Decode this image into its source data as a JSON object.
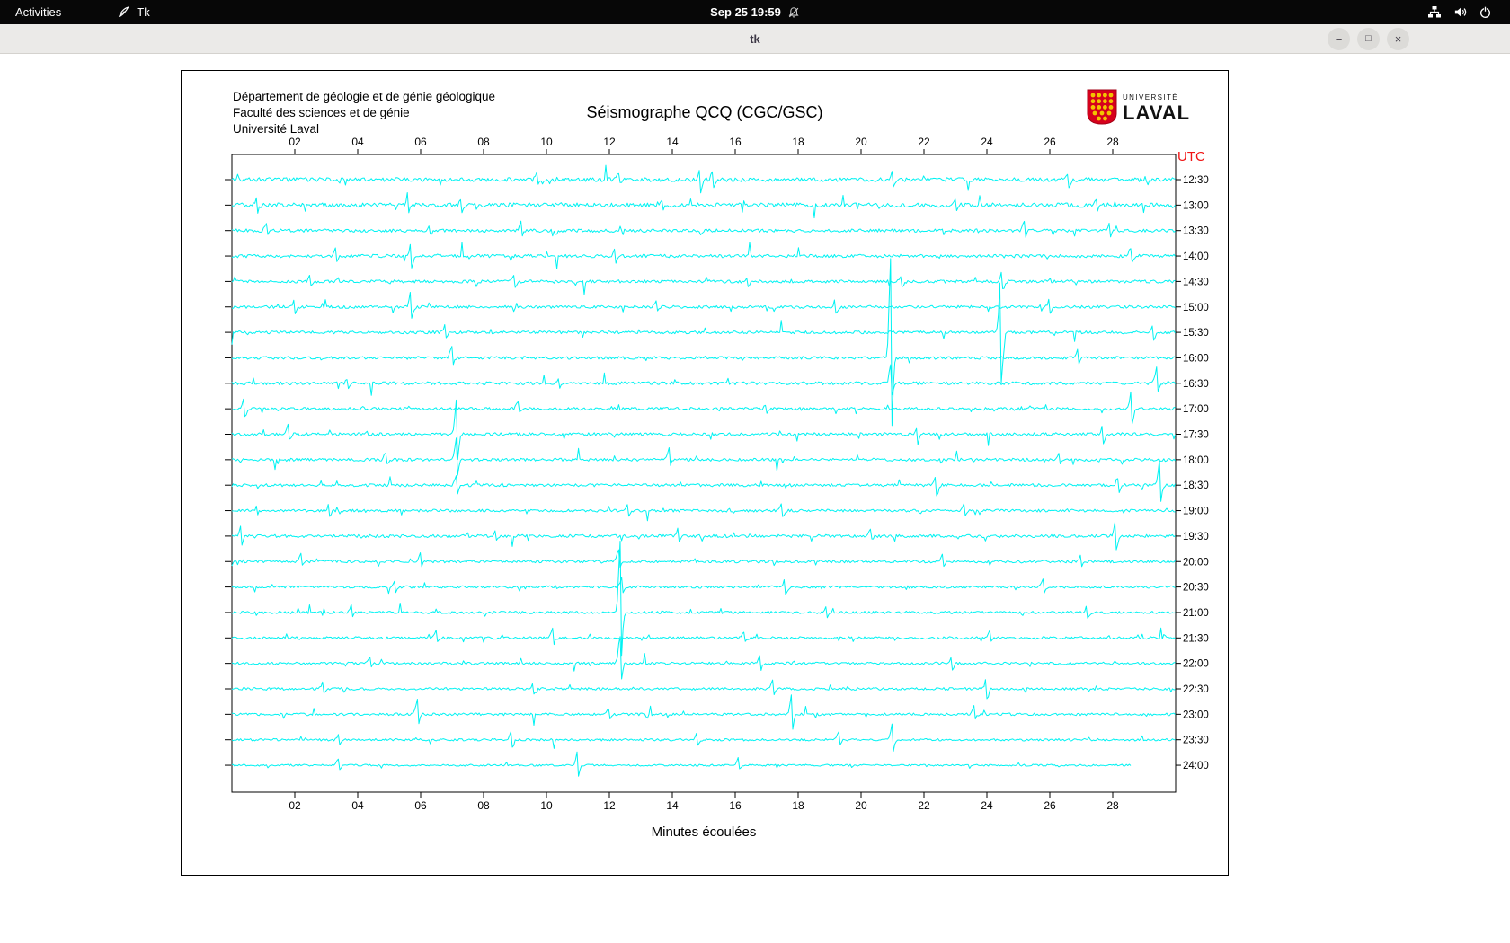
{
  "top_bar": {
    "activities": "Activities",
    "app_name": "Tk",
    "clock": "Sep 25 19:59",
    "icons": [
      "tk-feather-icon",
      "bell-muted-icon",
      "network-icon",
      "volume-icon",
      "power-icon"
    ]
  },
  "titlebar": {
    "title": "tk",
    "button_glyphs": {
      "minimize": "−",
      "maximize": "□",
      "close": "×"
    }
  },
  "seismograph": {
    "dept": [
      "Département de géologie et de génie géologique",
      "Faculté des sciences et de génie",
      "Université Laval"
    ],
    "title": "Séismographe QCQ (CGC/GSC)",
    "logo": {
      "line1": "UNIVERSITÉ",
      "line2": "LAVAL"
    },
    "utc_label": "UTC",
    "xlabel": "Minutes écoulées",
    "x_ticks": [
      "02",
      "04",
      "06",
      "08",
      "10",
      "12",
      "14",
      "16",
      "18",
      "20",
      "22",
      "24",
      "26",
      "28"
    ],
    "trace_color": "#00f2f2",
    "utc_color": "#f01414"
  },
  "chart_data": {
    "type": "line",
    "title": "Séismographe QCQ (CGC/GSC)",
    "xlabel": "Minutes écoulées",
    "ylabel_right": "UTC",
    "x_range": [
      0,
      30
    ],
    "x_ticks": [
      2,
      4,
      6,
      8,
      10,
      12,
      14,
      16,
      18,
      20,
      22,
      24,
      26,
      28
    ],
    "grid": false,
    "trace_spacing_minutes": 30,
    "traces": [
      {
        "label": "12:30",
        "seed": 1,
        "noise_amp": 2.2,
        "events": [
          [
            9.7,
            8
          ],
          [
            12.3,
            7
          ],
          [
            14.9,
            16
          ],
          [
            15.3,
            12
          ],
          [
            21.0,
            10
          ],
          [
            26.6,
            9
          ]
        ]
      },
      {
        "label": "13:00",
        "seed": 2,
        "noise_amp": 2.4,
        "events": [
          [
            0.8,
            10
          ],
          [
            5.6,
            12
          ],
          [
            7.3,
            8
          ],
          [
            13.7,
            7
          ],
          [
            23.0,
            8
          ],
          [
            27.5,
            9
          ]
        ]
      },
      {
        "label": "13:30",
        "seed": 3,
        "noise_amp": 1.8,
        "events": [
          [
            1.1,
            8
          ],
          [
            6.3,
            7
          ],
          [
            9.2,
            9
          ],
          [
            25.2,
            11
          ],
          [
            27.9,
            8
          ]
        ]
      },
      {
        "label": "14:00",
        "seed": 4,
        "noise_amp": 1.8,
        "events": [
          [
            3.3,
            9
          ],
          [
            5.7,
            16
          ],
          [
            12.2,
            8
          ],
          [
            28.6,
            9
          ]
        ]
      },
      {
        "label": "14:30",
        "seed": 5,
        "noise_amp": 1.7,
        "events": [
          [
            2.5,
            7
          ],
          [
            9.0,
            9
          ],
          [
            16.4,
            8
          ],
          [
            21.3,
            7
          ],
          [
            24.5,
            12
          ]
        ]
      },
      {
        "label": "15:00",
        "seed": 6,
        "noise_amp": 1.6,
        "events": [
          [
            2.0,
            8
          ],
          [
            5.7,
            18
          ],
          [
            13.5,
            7
          ],
          [
            19.2,
            9
          ],
          [
            26.0,
            10
          ]
        ]
      },
      {
        "label": "15:30",
        "seed": 7,
        "noise_amp": 1.6,
        "events": [
          [
            6.8,
            9
          ],
          [
            24.45,
            70
          ],
          [
            29.3,
            12
          ]
        ]
      },
      {
        "label": "16:00",
        "seed": 8,
        "noise_amp": 1.6,
        "events": [
          [
            7.0,
            14
          ],
          [
            20.95,
            115
          ],
          [
            26.9,
            10
          ]
        ]
      },
      {
        "label": "16:30",
        "seed": 9,
        "noise_amp": 1.7,
        "events": [
          [
            3.7,
            8
          ],
          [
            10.4,
            7
          ],
          [
            20.95,
            20
          ],
          [
            29.4,
            16
          ]
        ]
      },
      {
        "label": "17:00",
        "seed": 10,
        "noise_amp": 1.6,
        "events": [
          [
            0.4,
            12
          ],
          [
            9.1,
            8
          ],
          [
            17.0,
            7
          ],
          [
            28.6,
            22
          ]
        ]
      },
      {
        "label": "17:30",
        "seed": 11,
        "noise_amp": 1.7,
        "events": [
          [
            1.8,
            10
          ],
          [
            7.15,
            42
          ],
          [
            21.8,
            9
          ],
          [
            27.7,
            12
          ]
        ]
      },
      {
        "label": "18:00",
        "seed": 12,
        "noise_amp": 1.6,
        "events": [
          [
            4.9,
            9
          ],
          [
            7.15,
            25
          ],
          [
            13.9,
            12
          ],
          [
            26.3,
            8
          ]
        ]
      },
      {
        "label": "18:30",
        "seed": 13,
        "noise_amp": 1.6,
        "events": [
          [
            7.15,
            12
          ],
          [
            22.4,
            14
          ],
          [
            28.2,
            10
          ],
          [
            29.5,
            28
          ]
        ]
      },
      {
        "label": "19:00",
        "seed": 14,
        "noise_amp": 1.5,
        "events": [
          [
            3.1,
            7
          ],
          [
            12.6,
            8
          ],
          [
            17.5,
            10
          ],
          [
            23.3,
            9
          ]
        ]
      },
      {
        "label": "19:30",
        "seed": 15,
        "noise_amp": 1.7,
        "events": [
          [
            0.3,
            12
          ],
          [
            8.4,
            8
          ],
          [
            14.2,
            9
          ],
          [
            20.3,
            8
          ],
          [
            28.1,
            18
          ]
        ]
      },
      {
        "label": "20:00",
        "seed": 16,
        "noise_amp": 1.5,
        "events": [
          [
            2.2,
            8
          ],
          [
            6.0,
            9
          ],
          [
            12.3,
            14
          ],
          [
            22.6,
            8
          ],
          [
            27.0,
            7
          ]
        ]
      },
      {
        "label": "20:30",
        "seed": 17,
        "noise_amp": 1.4,
        "events": [
          [
            5.2,
            7
          ],
          [
            12.4,
            10
          ],
          [
            17.6,
            12
          ],
          [
            25.8,
            8
          ]
        ]
      },
      {
        "label": "21:00",
        "seed": 18,
        "noise_amp": 1.4,
        "events": [
          [
            3.8,
            8
          ],
          [
            12.35,
            78
          ],
          [
            18.9,
            7
          ],
          [
            27.2,
            9
          ]
        ]
      },
      {
        "label": "21:30",
        "seed": 19,
        "noise_amp": 1.4,
        "events": [
          [
            6.5,
            8
          ],
          [
            10.2,
            10
          ],
          [
            16.3,
            7
          ],
          [
            24.1,
            8
          ]
        ]
      },
      {
        "label": "22:00",
        "seed": 20,
        "noise_amp": 1.4,
        "events": [
          [
            4.4,
            7
          ],
          [
            12.35,
            30
          ],
          [
            16.8,
            9
          ],
          [
            22.9,
            8
          ]
        ]
      },
      {
        "label": "22:30",
        "seed": 21,
        "noise_amp": 1.4,
        "events": [
          [
            2.9,
            8
          ],
          [
            9.6,
            7
          ],
          [
            17.2,
            9
          ],
          [
            24.0,
            14
          ]
        ]
      },
      {
        "label": "23:00",
        "seed": 22,
        "noise_amp": 1.4,
        "events": [
          [
            5.9,
            16
          ],
          [
            12.0,
            8
          ],
          [
            17.8,
            24
          ],
          [
            23.6,
            9
          ]
        ]
      },
      {
        "label": "23:30",
        "seed": 23,
        "noise_amp": 1.3,
        "events": [
          [
            3.4,
            7
          ],
          [
            8.9,
            12
          ],
          [
            14.8,
            8
          ],
          [
            19.3,
            10
          ],
          [
            21.0,
            18
          ]
        ]
      },
      {
        "label": "24:00",
        "seed": 24,
        "noise_amp": 1.1,
        "end_minute": 28.6,
        "events": [
          [
            3.4,
            8
          ],
          [
            11.0,
            16
          ],
          [
            16.1,
            8
          ]
        ]
      }
    ]
  }
}
